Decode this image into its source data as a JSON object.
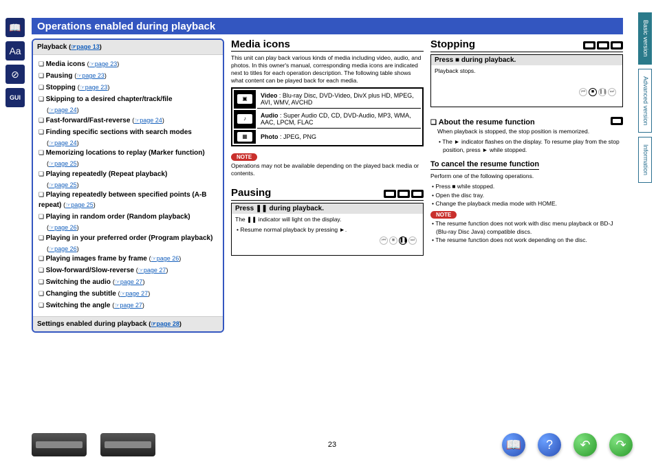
{
  "header": {
    "title": "Operations enabled during playback"
  },
  "sidebar_icons": [
    "book-icon",
    "aa-icon",
    "globe-icon",
    "gui-icon"
  ],
  "right_tabs": {
    "basic": "Basic version",
    "advanced": "Advanced version",
    "info": "Information"
  },
  "toc": {
    "header_label": "Playback",
    "header_page": "page 13",
    "items": [
      {
        "label": "Media icons",
        "page": "page 23"
      },
      {
        "label": "Pausing",
        "page": "page 23"
      },
      {
        "label": "Stopping",
        "page": "page 23"
      },
      {
        "label": "Skipping to a desired chapter/track/file",
        "page": "page 24",
        "page_on_next_line": true
      },
      {
        "label": "Fast-forward/Fast-reverse",
        "page": "page 24"
      },
      {
        "label": "Finding specific sections with search modes",
        "page": "page 24",
        "page_on_next_line": true
      },
      {
        "label": "Memorizing locations to replay (Marker function)",
        "page": "page 25",
        "page_on_next_line": true
      },
      {
        "label": "Playing repeatedly (Repeat playback)",
        "page": "page 25",
        "page_on_next_line": true
      },
      {
        "label": "Playing repeatedly between specified points (A-B repeat)",
        "page": "page 25"
      },
      {
        "label": "Playing in random order (Random playback)",
        "page": "page 26",
        "page_on_next_line": true
      },
      {
        "label": "Playing in your preferred order (Program playback)",
        "page": "page 26",
        "page_on_next_line": true
      },
      {
        "label": "Playing images frame by frame",
        "page": "page 26"
      },
      {
        "label": "Slow-forward/Slow-reverse",
        "page": "page 27"
      },
      {
        "label": "Switching the audio",
        "page": "page 27"
      },
      {
        "label": "Changing the subtitle",
        "page": "page 27"
      },
      {
        "label": "Switching the angle",
        "page": "page 27"
      }
    ],
    "footer_label": "Settings enabled during playback",
    "footer_page": "page 28"
  },
  "media_icons": {
    "title": "Media icons",
    "intro": "This unit can play back various kinds of media including video, audio, and photos. In this owner's manual, corresponding media icons are indicated next to titles for each operation description. The following table shows what content can be played back for each media.",
    "rows": [
      {
        "type": "Video",
        "text": "Blu-ray Disc, DVD-Video, DivX plus HD, MPEG, AVI, WMV, AVCHD"
      },
      {
        "type": "Audio",
        "text": "Super Audio CD, CD, DVD-Audio, MP3, WMA, AAC, LPCM, FLAC"
      },
      {
        "type": "Photo",
        "text": "JPEG, PNG"
      }
    ],
    "note_label": "NOTE",
    "note_text": "Operations may not be available depending on the played back media or contents."
  },
  "pausing": {
    "title": "Pausing",
    "press_label": "Press ❚❚ during playback.",
    "indicator_text": "The ❚❚ indicator will light on the display.",
    "resume_text": "Resume normal playback by pressing ►."
  },
  "stopping": {
    "title": "Stopping",
    "press_label": "Press ■ during playback.",
    "stops_text": "Playback stops.",
    "resume_title": "About the resume function",
    "resume_text1": "When playback is stopped, the stop position is memorized.",
    "resume_text2": "The ► indicator flashes on the display. To resume play from the stop position, press ► while stopped.",
    "cancel_title": "To cancel the resume function",
    "cancel_intro": "Perform one of the following operations.",
    "cancel_b1": "Press ■ while stopped.",
    "cancel_b2": "Open the disc tray.",
    "cancel_b3": "Change the playback media mode with HOME.",
    "note_label": "NOTE",
    "note_b1": "The resume function does not work with disc menu playback or BD-J (Blu-ray Disc Java) compatible discs.",
    "note_b2": "The resume function does not work depending on the disc."
  },
  "page_number": "23"
}
